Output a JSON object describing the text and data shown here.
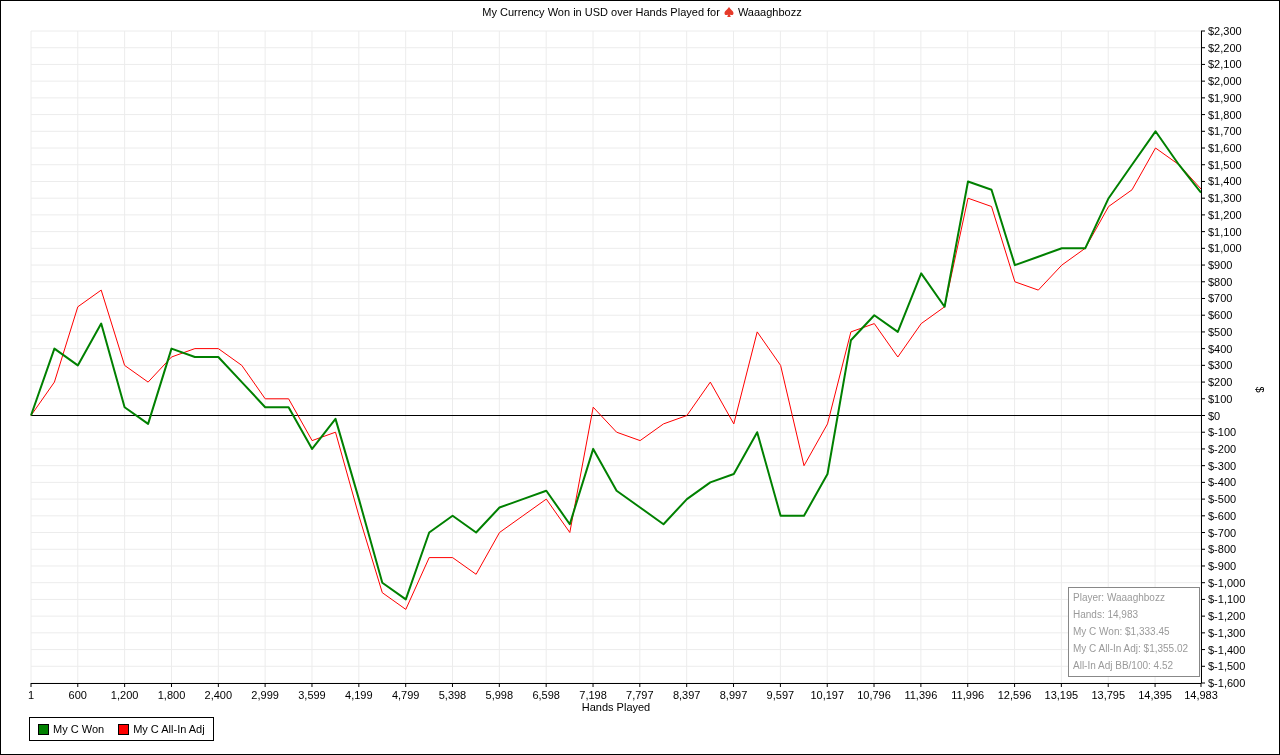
{
  "chart": {
    "player": "Waaaghbozz",
    "chart_data": {
      "type": "line",
      "title": "My Currency Won in USD over Hands Played for",
      "xlabel": "Hands Played",
      "ylabel": "$",
      "x": [
        1,
        300,
        600,
        900,
        1200,
        1500,
        1800,
        2100,
        2400,
        2700,
        3000,
        3300,
        3600,
        3900,
        4200,
        4500,
        4800,
        5100,
        5400,
        5700,
        6000,
        6300,
        6600,
        6900,
        7200,
        7500,
        7800,
        8100,
        8400,
        8700,
        9000,
        9300,
        9600,
        9900,
        10200,
        10500,
        10800,
        11100,
        11400,
        11700,
        12000,
        12300,
        12600,
        12900,
        13200,
        13500,
        13800,
        14100,
        14400,
        14700,
        14983
      ],
      "series": [
        {
          "name": "My C Won",
          "color": "#008000",
          "values": [
            0,
            400,
            300,
            550,
            50,
            -50,
            400,
            350,
            350,
            200,
            50,
            50,
            -200,
            -20,
            -500,
            -1000,
            -1100,
            -700,
            -600,
            -700,
            -550,
            -500,
            -450,
            -650,
            -200,
            -450,
            -550,
            -650,
            -500,
            -400,
            -350,
            -100,
            -600,
            -600,
            -350,
            450,
            600,
            500,
            850,
            650,
            1400,
            1350,
            900,
            950,
            1000,
            1000,
            1300,
            1500,
            1700,
            1500,
            1333
          ]
        },
        {
          "name": "My C All-In Adj",
          "color": "#ff0000",
          "values": [
            0,
            200,
            650,
            750,
            300,
            200,
            350,
            400,
            400,
            300,
            100,
            100,
            -150,
            -100,
            -600,
            -1060,
            -1160,
            -850,
            -850,
            -950,
            -700,
            -600,
            -500,
            -700,
            50,
            -100,
            -150,
            -50,
            0,
            200,
            -50,
            500,
            300,
            -300,
            -50,
            500,
            550,
            350,
            550,
            650,
            1300,
            1250,
            800,
            750,
            900,
            1000,
            1250,
            1350,
            1600,
            1500,
            1355
          ]
        }
      ],
      "grid": true,
      "xlim": [
        1,
        14983
      ],
      "ylim": [
        -1600,
        2300
      ],
      "xticks": [
        {
          "value": 1,
          "label": "1"
        },
        {
          "value": 600,
          "label": "600"
        },
        {
          "value": 1200,
          "label": "1,200"
        },
        {
          "value": 1800,
          "label": "1,800"
        },
        {
          "value": 2400,
          "label": "2,400"
        },
        {
          "value": 2999,
          "label": "2,999"
        },
        {
          "value": 3599,
          "label": "3,599"
        },
        {
          "value": 4199,
          "label": "4,199"
        },
        {
          "value": 4799,
          "label": "4,799"
        },
        {
          "value": 5398,
          "label": "5,398"
        },
        {
          "value": 5998,
          "label": "5,998"
        },
        {
          "value": 6598,
          "label": "6,598"
        },
        {
          "value": 7198,
          "label": "7,198"
        },
        {
          "value": 7797,
          "label": "7,797"
        },
        {
          "value": 8397,
          "label": "8,397"
        },
        {
          "value": 8997,
          "label": "8,997"
        },
        {
          "value": 9597,
          "label": "9,597"
        },
        {
          "value": 10197,
          "label": "10,197"
        },
        {
          "value": 10796,
          "label": "10,796"
        },
        {
          "value": 11396,
          "label": "11,396"
        },
        {
          "value": 11996,
          "label": "11,996"
        },
        {
          "value": 12596,
          "label": "12,596"
        },
        {
          "value": 13195,
          "label": "13,195"
        },
        {
          "value": 13795,
          "label": "13,795"
        },
        {
          "value": 14395,
          "label": "14,395"
        },
        {
          "value": 14983,
          "label": "14,983"
        }
      ],
      "yticks": [
        {
          "value": 2300,
          "label": "$2,300"
        },
        {
          "value": 2200,
          "label": "$2,200"
        },
        {
          "value": 2100,
          "label": "$2,100"
        },
        {
          "value": 2000,
          "label": "$2,000"
        },
        {
          "value": 1900,
          "label": "$1,900"
        },
        {
          "value": 1800,
          "label": "$1,800"
        },
        {
          "value": 1700,
          "label": "$1,700"
        },
        {
          "value": 1600,
          "label": "$1,600"
        },
        {
          "value": 1500,
          "label": "$1,500"
        },
        {
          "value": 1400,
          "label": "$1,400"
        },
        {
          "value": 1300,
          "label": "$1,300"
        },
        {
          "value": 1200,
          "label": "$1,200"
        },
        {
          "value": 1100,
          "label": "$1,100"
        },
        {
          "value": 1000,
          "label": "$1,000"
        },
        {
          "value": 900,
          "label": "$900"
        },
        {
          "value": 800,
          "label": "$800"
        },
        {
          "value": 700,
          "label": "$700"
        },
        {
          "value": 600,
          "label": "$600"
        },
        {
          "value": 500,
          "label": "$500"
        },
        {
          "value": 400,
          "label": "$400"
        },
        {
          "value": 300,
          "label": "$300"
        },
        {
          "value": 200,
          "label": "$200"
        },
        {
          "value": 100,
          "label": "$100"
        },
        {
          "value": 0,
          "label": "$0"
        },
        {
          "value": -100,
          "label": "$-100"
        },
        {
          "value": -200,
          "label": "$-200"
        },
        {
          "value": -300,
          "label": "$-300"
        },
        {
          "value": -400,
          "label": "$-400"
        },
        {
          "value": -500,
          "label": "$-500"
        },
        {
          "value": -600,
          "label": "$-600"
        },
        {
          "value": -700,
          "label": "$-700"
        },
        {
          "value": -800,
          "label": "$-800"
        },
        {
          "value": -900,
          "label": "$-900"
        },
        {
          "value": -1000,
          "label": "$-1,000"
        },
        {
          "value": -1100,
          "label": "$-1,100"
        },
        {
          "value": -1200,
          "label": "$-1,200"
        },
        {
          "value": -1300,
          "label": "$-1,300"
        },
        {
          "value": -1400,
          "label": "$-1,400"
        },
        {
          "value": -1500,
          "label": "$-1,500"
        },
        {
          "value": -1600,
          "label": "$-1,600"
        }
      ]
    },
    "info_box": [
      "Player: Waaaghbozz",
      "Hands: 14,983",
      "My C Won: $1,333.45",
      "My C All-In Adj: $1,355.02",
      "All-In Adj BB/100: 4.52"
    ]
  }
}
